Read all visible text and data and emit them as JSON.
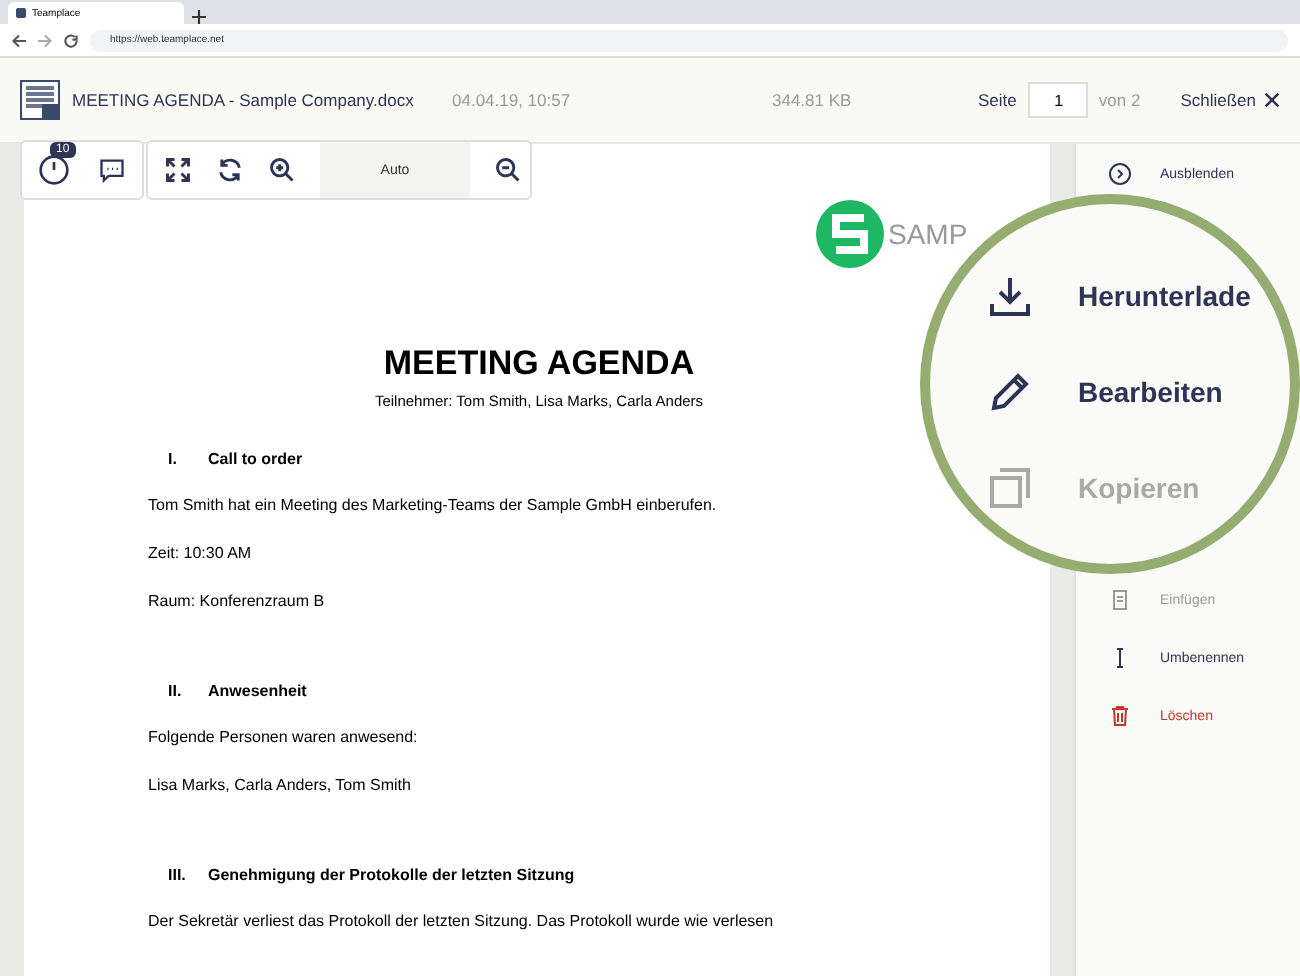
{
  "browser": {
    "tab_title": "Teamplace",
    "url": "https://web.teamplace.net"
  },
  "header": {
    "file_name": "MEETING AGENDA - Sample Company.docx",
    "date": "04.04.19, 10:57",
    "size": "344.81 KB",
    "page_label": "Seite",
    "page": "1",
    "page_total": "von 2",
    "close": "Schließen"
  },
  "toolbar": {
    "history_badge": "10",
    "zoom": "Auto"
  },
  "document": {
    "logo_text": "SAMP",
    "title": "MEETING AGENDA",
    "subtitle": "Teilnehmer: Tom Smith, Lisa Marks, Carla Anders",
    "blocks": [
      {
        "kind": "heading",
        "number": "I.",
        "text": "Call to order"
      },
      {
        "kind": "para",
        "text": "Tom Smith hat ein Meeting des Marketing-Teams der Sample GmbH einberufen."
      },
      {
        "kind": "para",
        "text": "Zeit: 10:30 AM"
      },
      {
        "kind": "para",
        "text": "Raum: Konferenzraum B"
      },
      {
        "kind": "heading",
        "number": "II.",
        "text": "Anwesenheit"
      },
      {
        "kind": "para",
        "text": "Folgende Personen waren anwesend:"
      },
      {
        "kind": "para",
        "text": "Lisa Marks, Carla Anders, Tom Smith"
      },
      {
        "kind": "heading",
        "number": "III.",
        "text": "Genehmigung der Protokolle der letzten Sitzung"
      },
      {
        "kind": "para",
        "text": "Der Sekretär verliest das Protokoll der letzten Sitzung. Das Protokoll wurde wie verlesen"
      }
    ]
  },
  "sidebar": {
    "items": [
      {
        "kind": "hide",
        "label": "Ausblenden",
        "disabled": false
      },
      {
        "kind": "paste",
        "label": "Einfügen",
        "disabled": true
      },
      {
        "kind": "rename",
        "label": "Umbenennen",
        "disabled": false
      },
      {
        "kind": "delete",
        "label": "Löschen",
        "disabled": false
      }
    ]
  },
  "magnifier": {
    "items": [
      {
        "kind": "download",
        "label": "Herunterlade",
        "disabled": false
      },
      {
        "kind": "edit",
        "label": "Bearbeiten",
        "disabled": false
      },
      {
        "kind": "copy",
        "label": "Kopieren",
        "disabled": true
      }
    ]
  }
}
